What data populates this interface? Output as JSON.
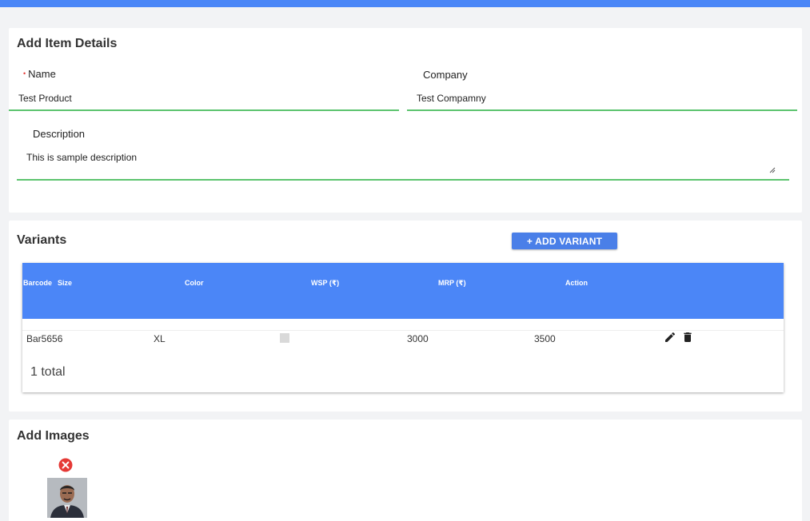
{
  "item_details": {
    "title": "Add Item Details",
    "name_label": "Name",
    "name_value": "Test Product",
    "company_label": "Company",
    "company_value": "Test Compamny",
    "description_label": "Description",
    "description_value": "This is sample description"
  },
  "variants": {
    "title": "Variants",
    "add_button": "+ ADD VARIANT",
    "headers": [
      "Barcode",
      "Size",
      "Color",
      "WSP (₹)",
      "MRP (₹)",
      "Action"
    ],
    "rows": [
      {
        "barcode": "Bar5656",
        "size": "XL",
        "color": "#d9d9d9",
        "wsp": "3000",
        "mrp": "3500"
      }
    ],
    "total": "1 total"
  },
  "images": {
    "title": "Add Images"
  },
  "colors": {
    "accent": "#4a86f7",
    "valid_underline": "#5cc46f",
    "delete_red": "#e53935"
  }
}
